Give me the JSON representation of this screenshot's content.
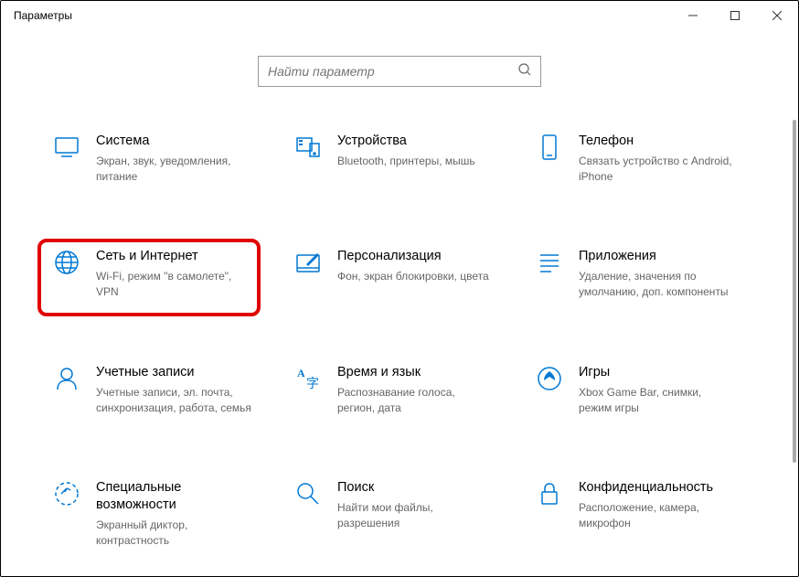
{
  "window": {
    "title": "Параметры"
  },
  "search": {
    "placeholder": "Найти параметр"
  },
  "cells": [
    {
      "id": "system",
      "title": "Система",
      "desc": "Экран, звук, уведомления, питание"
    },
    {
      "id": "devices",
      "title": "Устройства",
      "desc": "Bluetooth, принтеры, мышь"
    },
    {
      "id": "phone",
      "title": "Телефон",
      "desc": "Связать устройство с Android, iPhone"
    },
    {
      "id": "network",
      "title": "Сеть и Интернет",
      "desc": "Wi-Fi, режим \"в самолете\", VPN"
    },
    {
      "id": "personalization",
      "title": "Персонализация",
      "desc": "Фон, экран блокировки, цвета"
    },
    {
      "id": "apps",
      "title": "Приложения",
      "desc": "Удаление, значения по умолчанию, доп. компоненты"
    },
    {
      "id": "accounts",
      "title": "Учетные записи",
      "desc": "Учетные записи, эл. почта, синхронизация, работа, семья"
    },
    {
      "id": "time",
      "title": "Время и язык",
      "desc": "Распознавание голоса, регион, дата"
    },
    {
      "id": "gaming",
      "title": "Игры",
      "desc": "Xbox Game Bar, снимки, режим игры"
    },
    {
      "id": "access",
      "title": "Специальные возможности",
      "desc": "Экранный диктор, контрастность"
    },
    {
      "id": "search_cat",
      "title": "Поиск",
      "desc": "Найти мои файлы, разрешения"
    },
    {
      "id": "privacy",
      "title": "Конфиденциальность",
      "desc": "Расположение, камера, микрофон"
    }
  ]
}
